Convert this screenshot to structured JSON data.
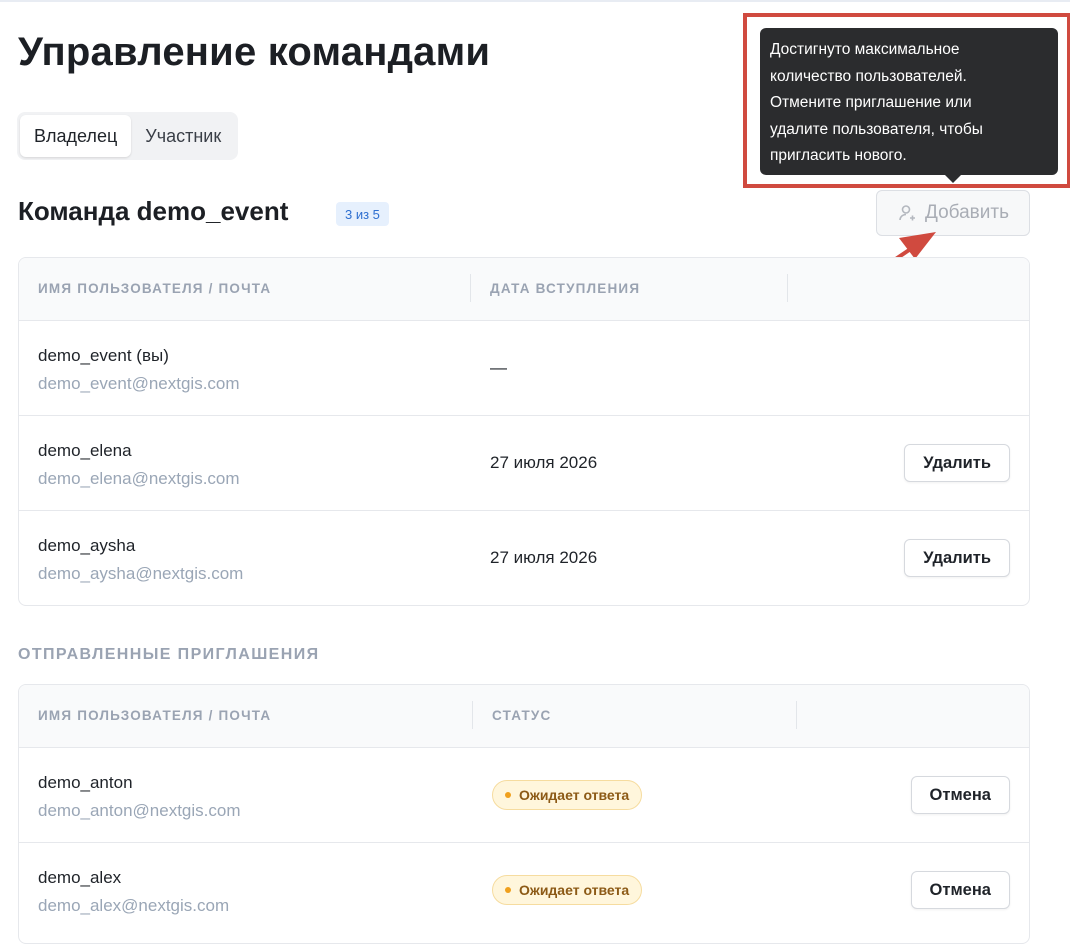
{
  "page": {
    "title": "Управление командами"
  },
  "tabs": [
    {
      "label": "Владелец",
      "active": true
    },
    {
      "label": "Участник",
      "active": false
    }
  ],
  "team": {
    "title": "Команда demo_event",
    "count_badge": "3 из 5",
    "add_button": {
      "label": "Добавить",
      "icon": "user-add-icon",
      "disabled": true
    }
  },
  "tooltip": {
    "lines": [
      "Достигнуто максимальное",
      "количество пользователей.",
      "Отмените приглашение или",
      "удалите пользователя, чтобы",
      "пригласить нового."
    ]
  },
  "members_table": {
    "columns": [
      "ИМЯ ПОЛЬЗОВАТЕЛЯ / ПОЧТА",
      "ДАТА ВСТУПЛЕНИЯ"
    ],
    "rows": [
      {
        "name": "demo_event (вы)",
        "email": "demo_event@nextgis.com",
        "date": "—",
        "action": ""
      },
      {
        "name": "demo_elena",
        "email": "demo_elena@nextgis.com",
        "date": "27 июля 2026",
        "action": "Удалить"
      },
      {
        "name": "demo_aysha",
        "email": "demo_aysha@nextgis.com",
        "date": "27 июля 2026",
        "action": "Удалить"
      }
    ]
  },
  "invites": {
    "section_label": "ОТПРАВЛЕННЫЕ ПРИГЛАШЕНИЯ",
    "columns": [
      "ИМЯ ПОЛЬЗОВАТЕЛЯ / ПОЧТА",
      "СТАТУС"
    ],
    "rows": [
      {
        "name": "demo_anton",
        "email": "demo_anton@nextgis.com",
        "status": "Ожидает ответа",
        "action": "Отмена"
      },
      {
        "name": "demo_alex",
        "email": "demo_alex@nextgis.com",
        "status": "Ожидает ответа",
        "action": "Отмена"
      }
    ]
  },
  "colors": {
    "annotation": "#d04a3f",
    "badge_blue": "#2e6fd0",
    "status_pending": "#f0a01d"
  }
}
